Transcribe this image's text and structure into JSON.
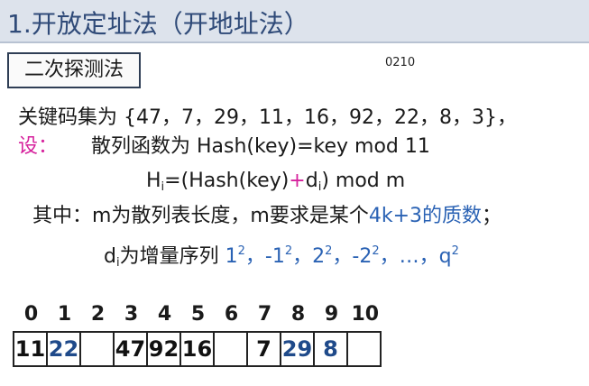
{
  "header": {
    "title": "1.开放定址法（开地址法）"
  },
  "tag_label": "二次探测法",
  "corner_code": "0210",
  "keys_line": "关键码集为 {47，7，29，11，16，92，22，8，3}，",
  "let_label": "设：",
  "hash_def": "散列函数为  Hash(key)=key mod 11",
  "formula": {
    "h": "H",
    "i": "i",
    "eq": "=(Hash(key)",
    "plus": "+",
    "d": "d",
    "di": "i",
    "rest": ") mod m"
  },
  "m_line": {
    "prefix": "其中：m为散列表长度，m要求是某个",
    "highlight": "4k+3的质数",
    "suffix": "；"
  },
  "d_line": {
    "d": "d",
    "i": "i",
    "text": "为增量序列 ",
    "seq": [
      {
        "base": "1",
        "exp": "2",
        "sep": "，"
      },
      {
        "base": "-1",
        "exp": "2",
        "sep": "，"
      },
      {
        "base": "2",
        "exp": "2",
        "sep": "，"
      },
      {
        "base": "-2",
        "exp": "2",
        "sep": "，…，"
      },
      {
        "base": "q",
        "exp": "2",
        "sep": ""
      }
    ]
  },
  "table": {
    "indices": [
      "0",
      "1",
      "2",
      "3",
      "4",
      "5",
      "6",
      "7",
      "8",
      "9",
      "10"
    ],
    "cells": [
      {
        "value": "11",
        "probed": false
      },
      {
        "value": "22",
        "probed": true
      },
      {
        "value": "",
        "probed": false
      },
      {
        "value": "47",
        "probed": false
      },
      {
        "value": "92",
        "probed": false
      },
      {
        "value": "16",
        "probed": false
      },
      {
        "value": "",
        "probed": false
      },
      {
        "value": "7",
        "probed": false
      },
      {
        "value": "29",
        "probed": true
      },
      {
        "value": "8",
        "probed": true
      },
      {
        "value": "",
        "probed": false
      }
    ]
  },
  "colors": {
    "accent_pink": "#d6209c",
    "accent_blue": "#2a62b4",
    "probed_value": "#1f4a8a",
    "title": "#2f4a78"
  }
}
